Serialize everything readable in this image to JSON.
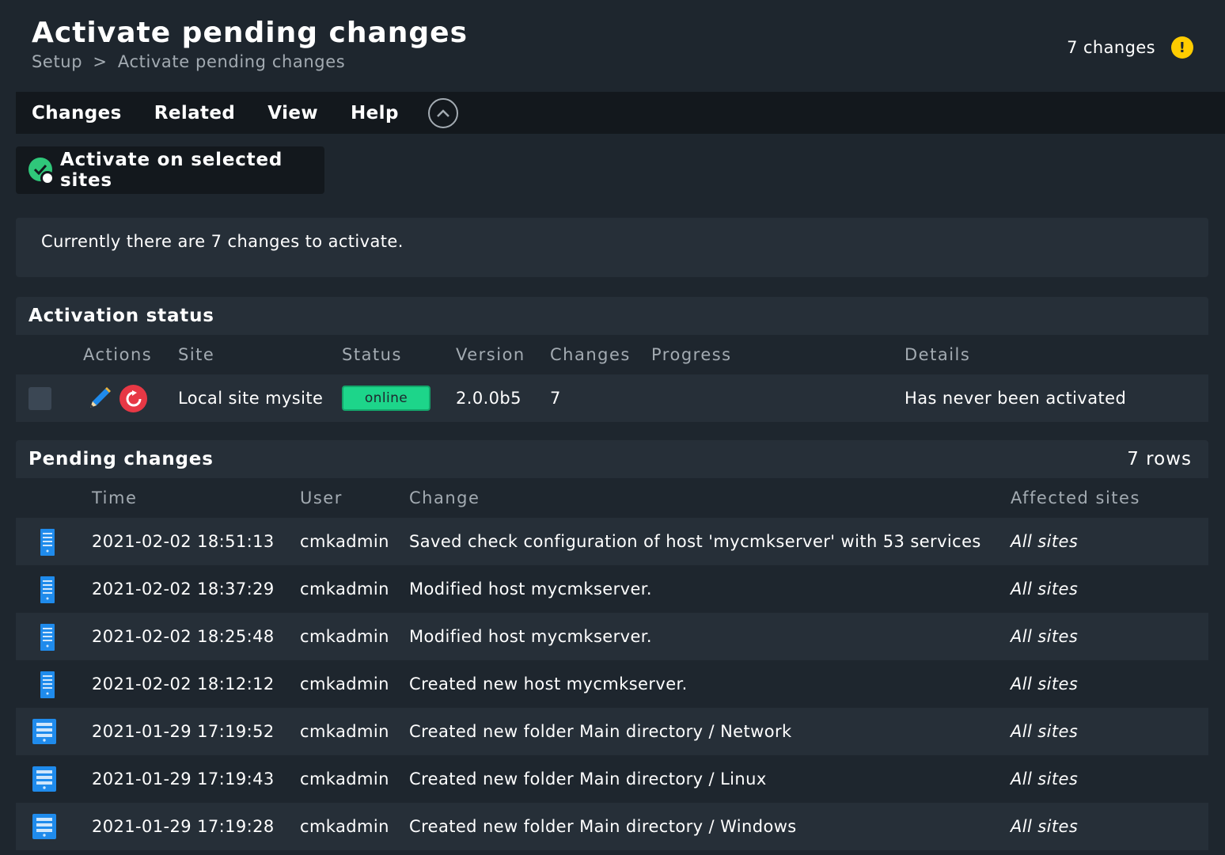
{
  "header": {
    "title": "Activate pending changes",
    "breadcrumb": [
      "Setup",
      "Activate pending changes"
    ],
    "breadcrumb_sep": ">",
    "changes_label": "7 changes",
    "warning_glyph": "!"
  },
  "menu": {
    "items": [
      "Changes",
      "Related",
      "View",
      "Help"
    ]
  },
  "action": {
    "label": "Activate on selected sites"
  },
  "info": {
    "text": "Currently there are 7 changes to activate."
  },
  "activation": {
    "title": "Activation status",
    "columns": [
      "Actions",
      "Site",
      "Status",
      "Version",
      "Changes",
      "Progress",
      "Details"
    ],
    "row": {
      "site": "Local site mysite",
      "status": "online",
      "version": "2.0.0b5",
      "changes": "7",
      "progress": "",
      "details": "Has never been activated"
    }
  },
  "pending": {
    "title": "Pending changes",
    "row_count": "7 rows",
    "columns": [
      "Time",
      "User",
      "Change",
      "Affected sites"
    ],
    "rows": [
      {
        "icon": "host-icon",
        "time": "2021-02-02 18:51:13",
        "user": "cmkadmin",
        "change": "Saved check configuration of host 'mycmkserver' with 53 services",
        "sites": "All sites"
      },
      {
        "icon": "host-icon",
        "time": "2021-02-02 18:37:29",
        "user": "cmkadmin",
        "change": "Modified host mycmkserver.",
        "sites": "All sites"
      },
      {
        "icon": "host-icon",
        "time": "2021-02-02 18:25:48",
        "user": "cmkadmin",
        "change": "Modified host mycmkserver.",
        "sites": "All sites"
      },
      {
        "icon": "host-icon",
        "time": "2021-02-02 18:12:12",
        "user": "cmkadmin",
        "change": "Created new host mycmkserver.",
        "sites": "All sites"
      },
      {
        "icon": "folder-icon",
        "time": "2021-01-29 17:19:52",
        "user": "cmkadmin",
        "change": "Created new folder Main directory / Network",
        "sites": "All sites"
      },
      {
        "icon": "folder-icon",
        "time": "2021-01-29 17:19:43",
        "user": "cmkadmin",
        "change": "Created new folder Main directory / Linux",
        "sites": "All sites"
      },
      {
        "icon": "folder-icon",
        "time": "2021-01-29 17:19:28",
        "user": "cmkadmin",
        "change": "Created new folder Main directory / Windows",
        "sites": "All sites"
      }
    ]
  },
  "colors": {
    "background": "#1e262e",
    "panel": "#262f38",
    "menubar": "#13181d",
    "online": "#1dd58a",
    "warning": "#ffcc00",
    "accent_blue": "#1f8bec"
  }
}
